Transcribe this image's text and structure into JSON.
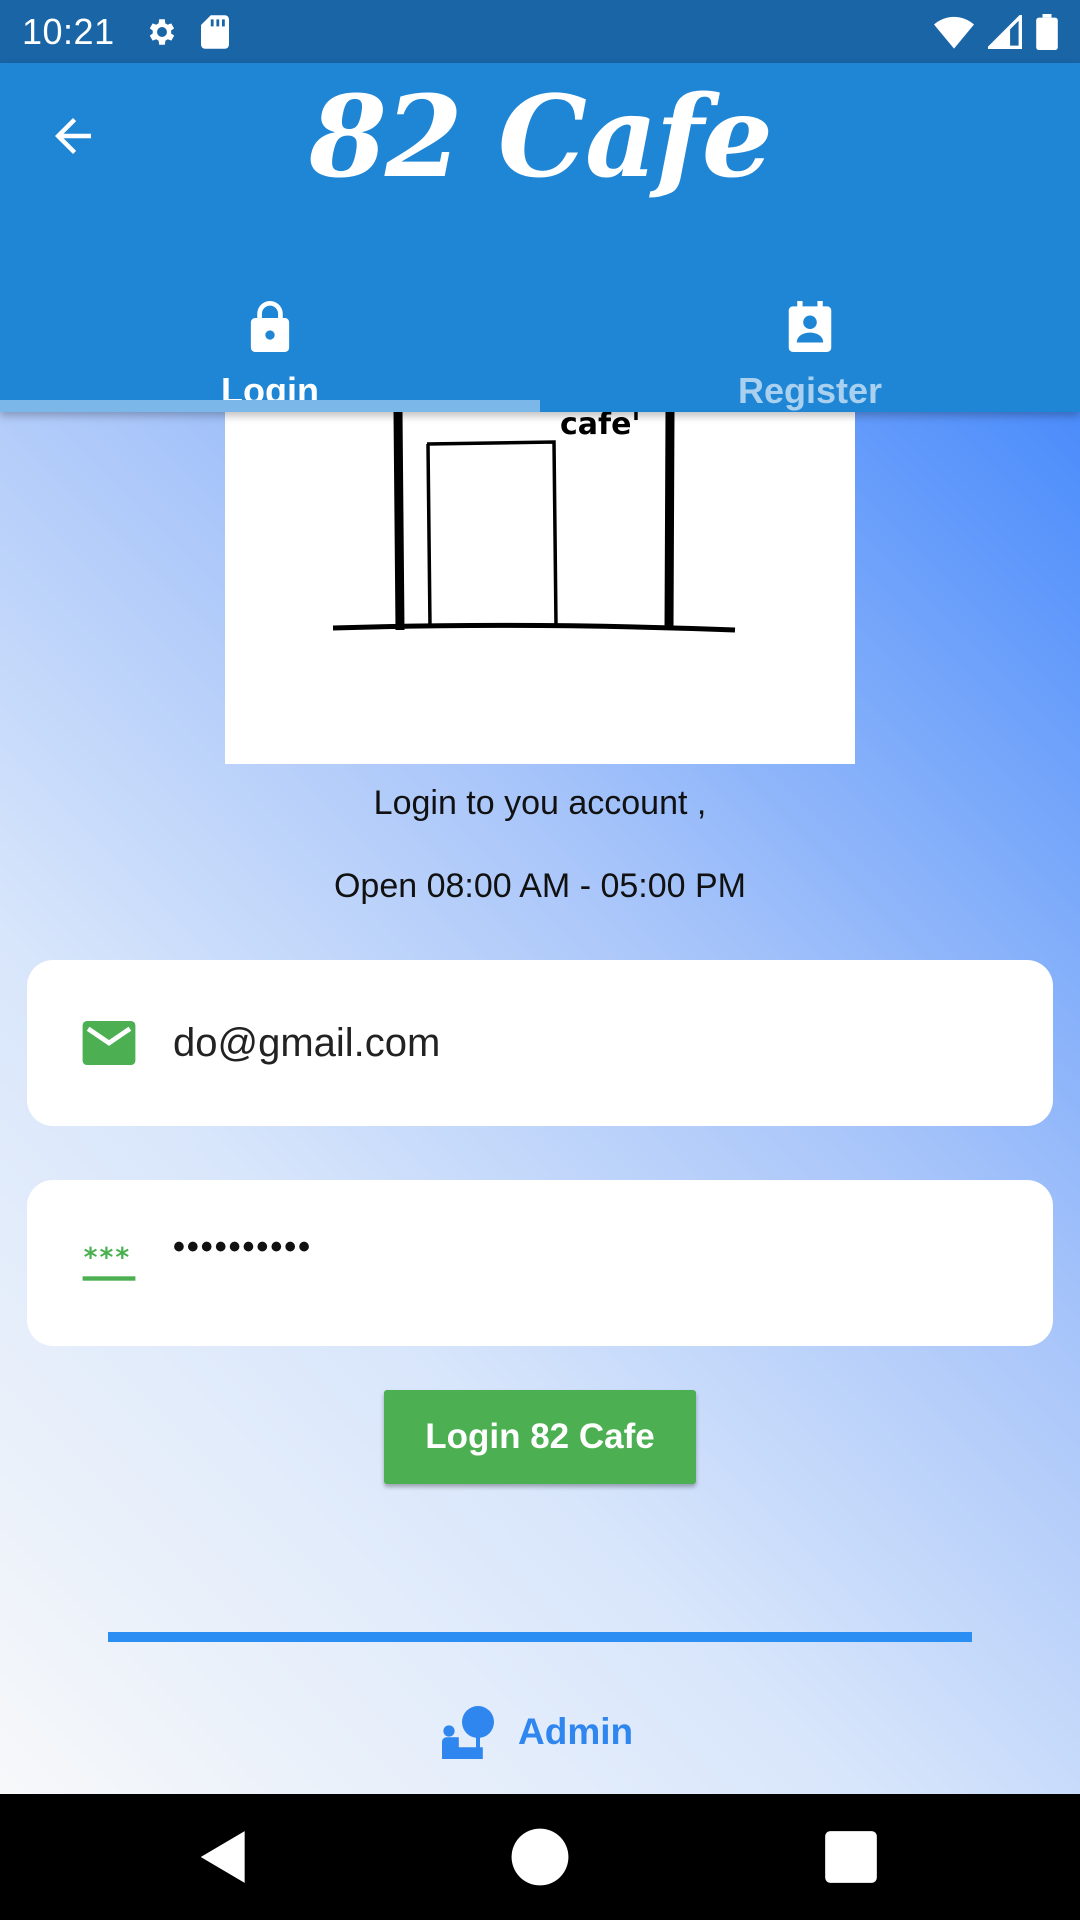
{
  "status_bar": {
    "time": "10:21",
    "left_icons": [
      "gear-icon",
      "sd-card-icon"
    ],
    "right_icons": [
      "wifi-icon",
      "signal-icon",
      "battery-icon"
    ],
    "background": "#1a65a6"
  },
  "app_bar": {
    "title": "82 Cafe",
    "background": "#1f86d6",
    "back_icon": "arrow-back-icon"
  },
  "tabs": [
    {
      "label": "Login",
      "icon": "lock-icon",
      "selected": true
    },
    {
      "label": "Register",
      "icon": "contact-card-icon",
      "selected": false
    }
  ],
  "main": {
    "image_caption": "cafe'",
    "greeting": "Login to you account ,",
    "hours": "Open  08:00 AM - 05:00 PM",
    "email_field": {
      "value": "do@gmail.com",
      "icon": "mail-icon"
    },
    "password_field": {
      "value": "••••••••••",
      "icon": "password-icon"
    },
    "login_button": "Login 82 Cafe",
    "admin_link": "Admin",
    "accent_green": "#4cb052",
    "accent_blue": "#2a8ef2"
  },
  "nav_bar": {
    "buttons": [
      "back-triangle-icon",
      "home-circle-icon",
      "recents-square-icon"
    ]
  }
}
